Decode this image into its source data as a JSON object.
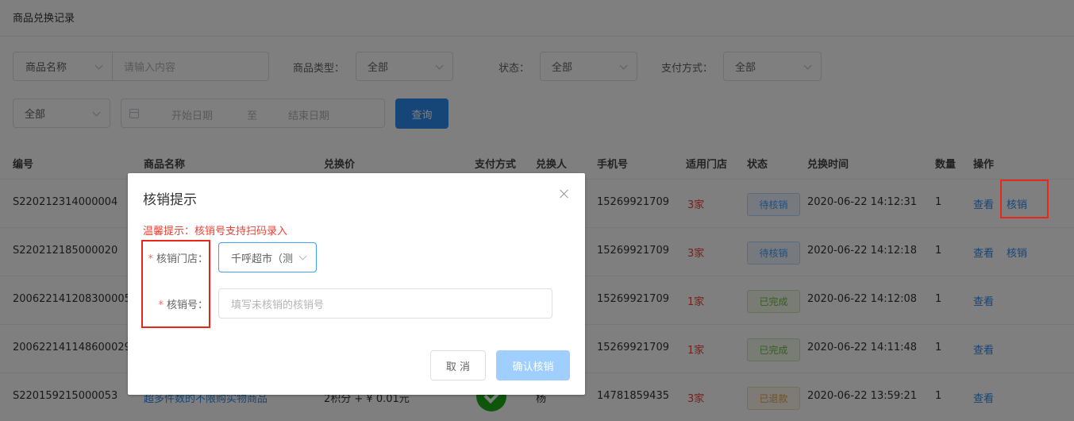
{
  "page": {
    "title": "商品兑换记录"
  },
  "filters": {
    "search_type": "商品名称",
    "search_placeholder": "请输入内容",
    "type_label": "商品类型：",
    "type_value": "全部",
    "status_label": "状态：",
    "status_value": "全部",
    "pay_label": "支付方式：",
    "pay_value": "全部",
    "extra_value": "全部",
    "start_date": "开始日期",
    "to": "至",
    "end_date": "结束日期",
    "query_button": "查询"
  },
  "table": {
    "headers": [
      "编号",
      "商品名称",
      "兑换价",
      "支付方式",
      "兑换人",
      "手机号",
      "适用门店",
      "状态",
      "兑换时间",
      "数量",
      "操作"
    ],
    "rows": [
      {
        "id": "S220212314000004",
        "name": "",
        "price": "",
        "phone": "15269921709",
        "store": "3家",
        "status": "待核销",
        "time": "2020-06-22 14:12:31",
        "qty": "1",
        "view": "查看",
        "verify": "核销"
      },
      {
        "id": "S220212185000020",
        "name": "",
        "price": "",
        "phone": "15269921709",
        "store": "3家",
        "status": "待核销",
        "time": "2020-06-22 14:12:18",
        "qty": "1",
        "view": "查看",
        "verify": "核销"
      },
      {
        "id": "2006221412083000059",
        "name": "",
        "price": "",
        "phone": "15269921709",
        "store": "1家",
        "status": "已完成",
        "time": "2020-06-22 14:12:08",
        "qty": "1",
        "view": "查看",
        "verify": ""
      },
      {
        "id": "2006221411486000295",
        "name": "",
        "price": "",
        "phone": "15269921709",
        "store": "1家",
        "status": "已完成",
        "time": "2020-06-22 14:11:48",
        "qty": "1",
        "view": "查看",
        "verify": ""
      },
      {
        "id": "S220159215000053",
        "name": "超多件数的不限购实物商品",
        "price": "2积分 + ¥ 0.01元",
        "user": "杨",
        "phone": "14781859435",
        "store": "3家",
        "status": "已退款",
        "time": "2020-06-22 13:59:21",
        "qty": "1",
        "view": "查看",
        "verify": ""
      }
    ]
  },
  "dialog": {
    "title": "核销提示",
    "tip": "温馨提示：核销号支持扫码录入",
    "store_label": "核销门店：",
    "store_value": "千呼超市（测",
    "code_label": "核销号：",
    "code_placeholder": "填写未核销的核销号",
    "cancel": "取 消",
    "confirm": "确认核销"
  },
  "colors": {
    "primary": "#2d8cf0",
    "danger": "#f04134",
    "highlight_box": "#e8261a"
  }
}
